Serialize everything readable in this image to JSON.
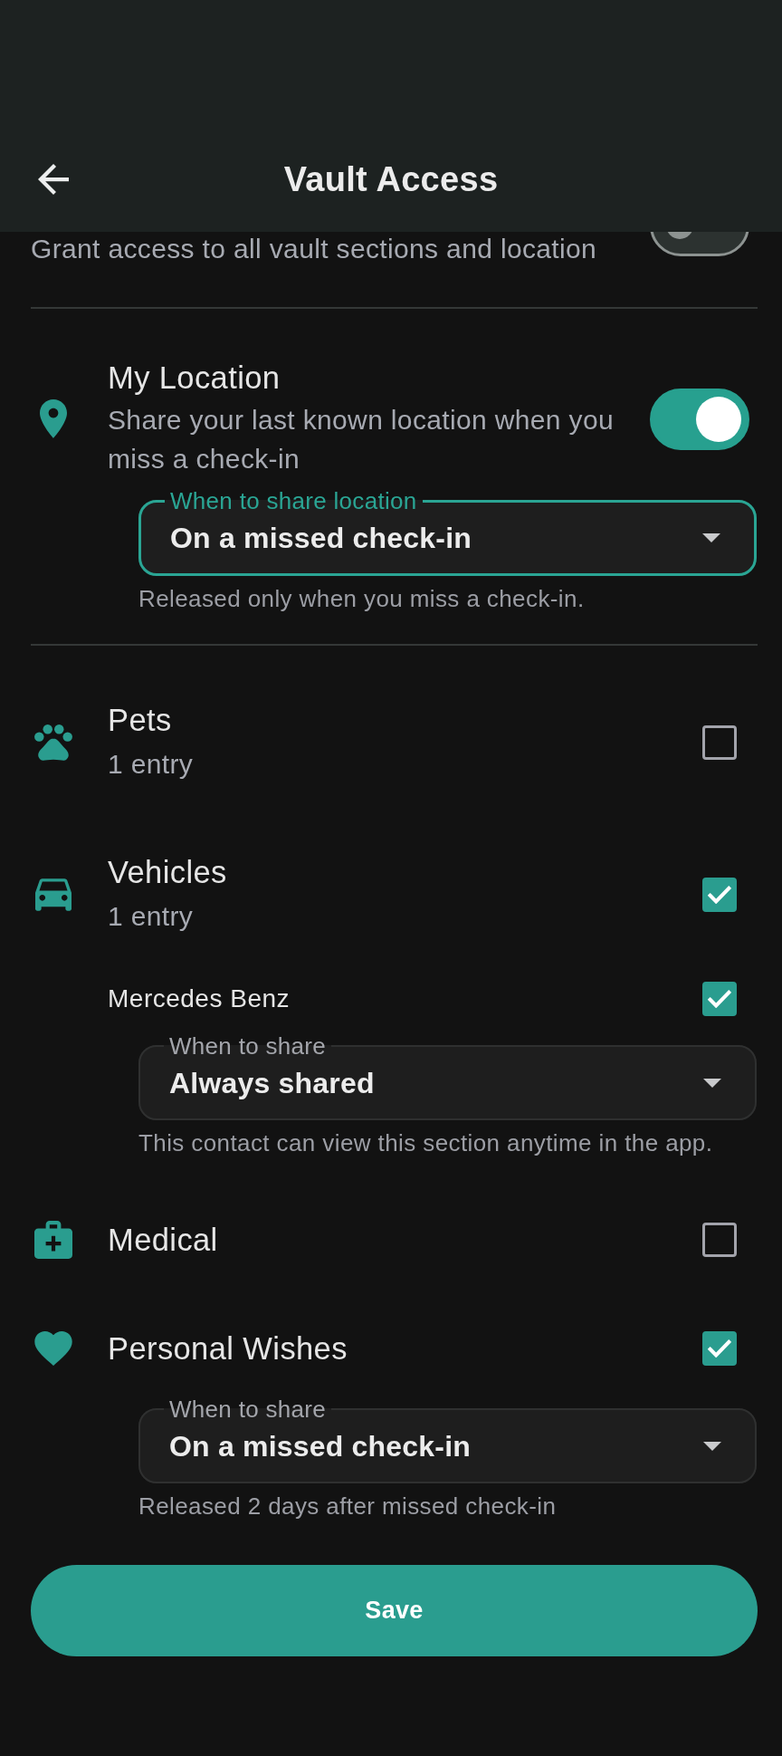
{
  "app_bar": {
    "title": "Vault Access"
  },
  "full_access": {
    "description": "Grant access to all vault sections and location",
    "on": false
  },
  "location": {
    "title": "My Location",
    "description": "Share your last known location when you miss a check-in",
    "on": true,
    "share_when": {
      "label": "When to share location",
      "value": "On a missed check-in",
      "helper": "Released only when you miss a check-in.",
      "focused": true
    }
  },
  "sections": [
    {
      "kind": "pets",
      "title": "Pets",
      "subtitle": "1 entry",
      "checked": false
    },
    {
      "kind": "vehicles",
      "title": "Vehicles",
      "subtitle": "1 entry",
      "checked": true,
      "entries": [
        {
          "title": "Mercedes Benz",
          "checked": true,
          "share_when": {
            "label": "When to share",
            "value": "Always shared",
            "helper": "This contact can view this section anytime in the app.",
            "focused": false
          }
        }
      ]
    },
    {
      "kind": "medical",
      "title": "Medical",
      "checked": false
    },
    {
      "kind": "wishes",
      "title": "Personal Wishes",
      "checked": true,
      "share_when": {
        "label": "When to share",
        "value": "On a missed check-in",
        "helper": "Released 2 days after missed check-in",
        "focused": false
      }
    }
  ],
  "save_button": {
    "label": "Save"
  }
}
